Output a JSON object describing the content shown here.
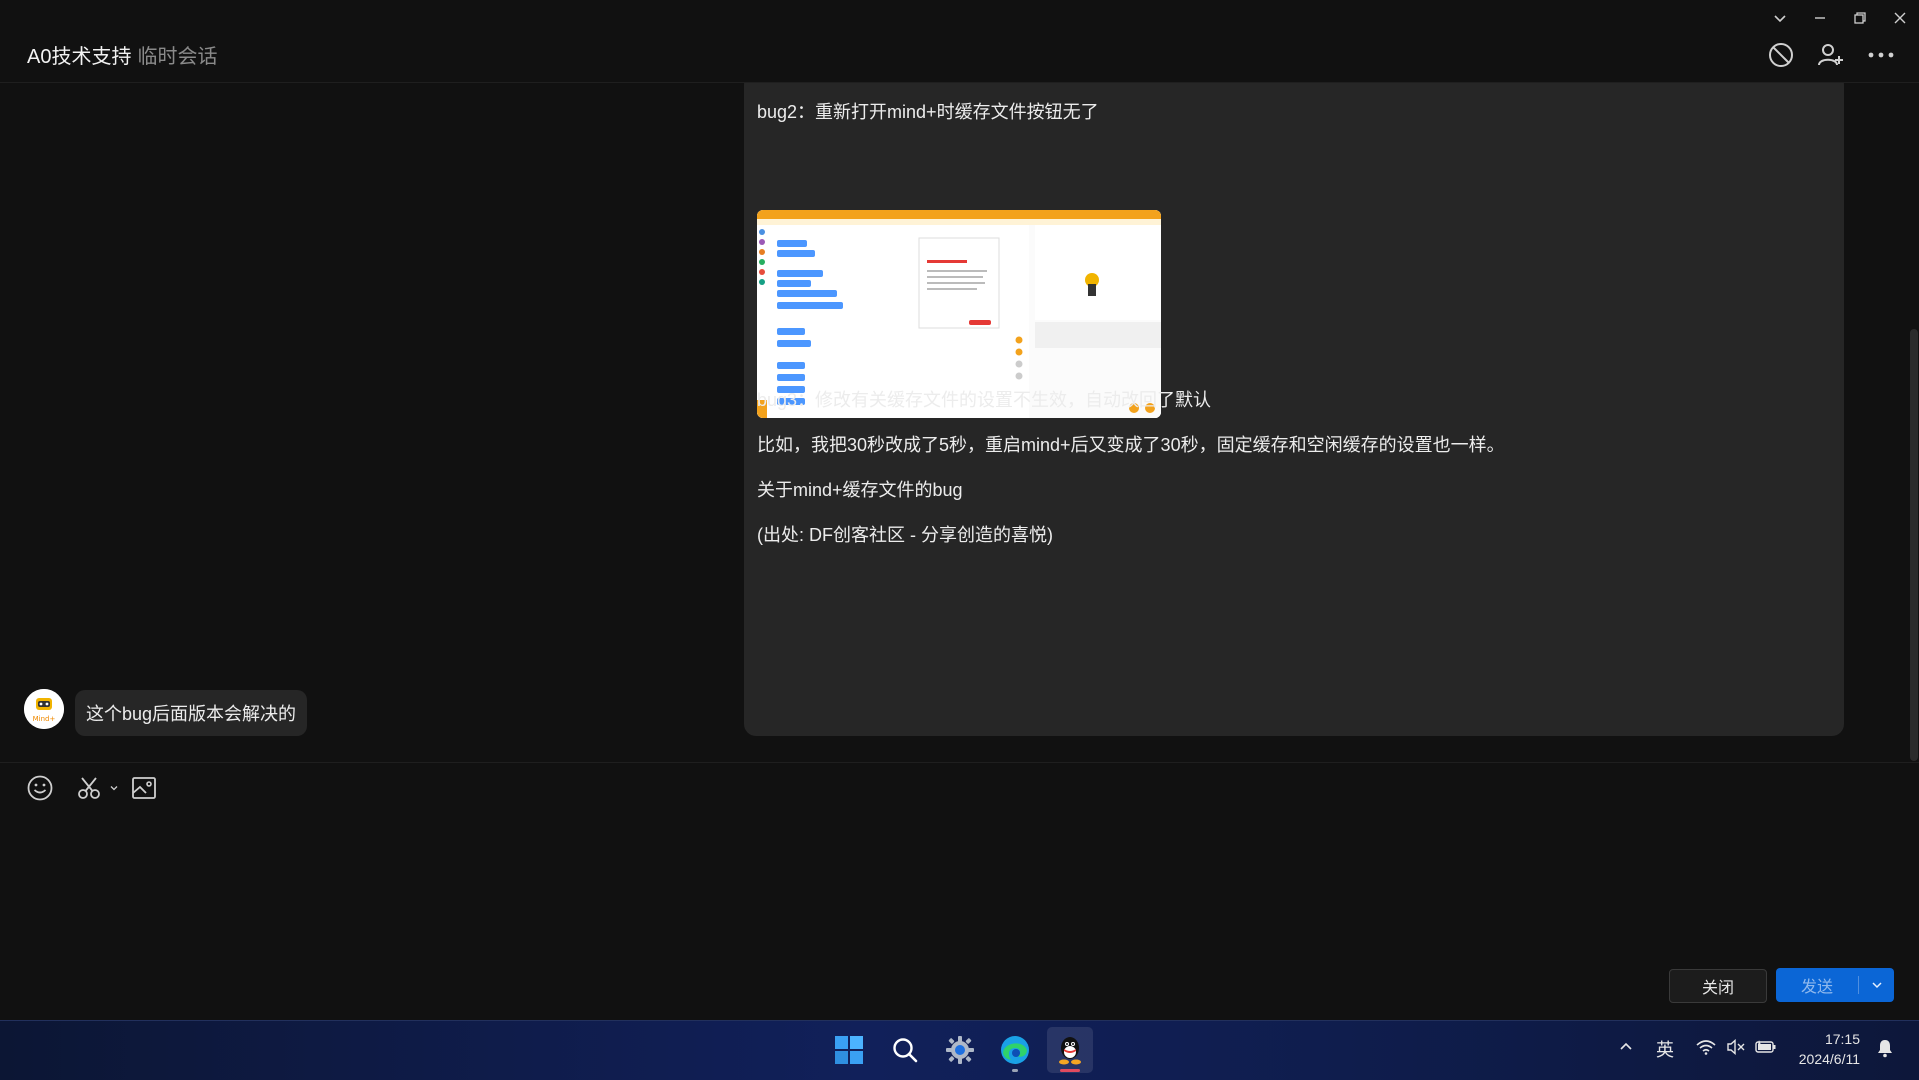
{
  "window": {
    "title": "A0技术支持",
    "subtitle": "临时会话"
  },
  "messages": {
    "main_lines": [
      "bug2：重新打开mind+时缓存文件按钮无了",
      "bug3：修改有关缓存文件的设置不生效，自动改回了默认",
      "比如，我把30秒改成了5秒，重启mind+后又变成了30秒，固定缓存和空闲缓存的设置也一样。",
      "关于mind+缓存文件的bug",
      "(出处: DF创客社区 - 分享创造的喜悦)"
    ],
    "reply": "这个bug后面版本会解决的",
    "avatar_text": "Mind+"
  },
  "composer": {
    "input_value": "",
    "close_label": "关闭",
    "send_label": "发送"
  },
  "taskbar": {
    "ime": "英",
    "time": "17:15",
    "date": "2024/6/11"
  },
  "colors": {
    "send_button": "#0b66d6",
    "background": "#111111",
    "bubble": "#262626",
    "qq_underline": "#e04a5f"
  }
}
